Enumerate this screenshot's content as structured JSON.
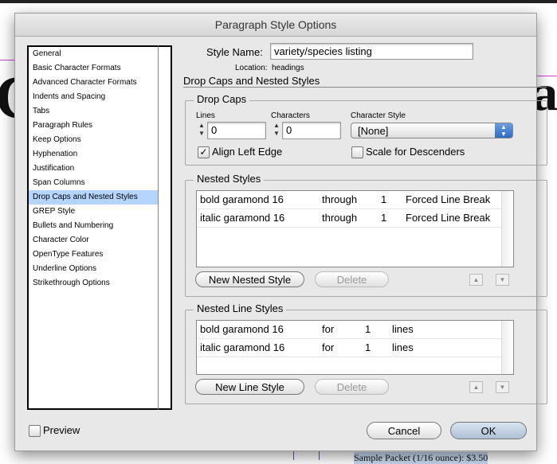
{
  "dialog": {
    "title": "Paragraph Style Options"
  },
  "sidebar": {
    "items": [
      {
        "label": "General"
      },
      {
        "label": "Basic Character Formats"
      },
      {
        "label": "Advanced Character Formats"
      },
      {
        "label": "Indents and Spacing"
      },
      {
        "label": "Tabs"
      },
      {
        "label": "Paragraph Rules"
      },
      {
        "label": "Keep Options"
      },
      {
        "label": "Hyphenation"
      },
      {
        "label": "Justification"
      },
      {
        "label": "Span Columns"
      },
      {
        "label": "Drop Caps and Nested Styles",
        "selected": true
      },
      {
        "label": "GREP Style"
      },
      {
        "label": "Bullets and Numbering"
      },
      {
        "label": "Character Color"
      },
      {
        "label": "OpenType Features"
      },
      {
        "label": "Underline Options"
      },
      {
        "label": "Strikethrough Options"
      }
    ]
  },
  "style_name": {
    "label": "Style Name:",
    "value": "variety/species listing"
  },
  "location": {
    "label": "Location:",
    "value": "headings"
  },
  "section_title": "Drop Caps and Nested Styles",
  "drop_caps": {
    "title": "Drop Caps",
    "lines_label": "Lines",
    "lines_value": "0",
    "characters_label": "Characters",
    "characters_value": "0",
    "char_style_label": "Character Style",
    "char_style_value": "[None]",
    "align_left_edge": {
      "label": "Align Left Edge",
      "checked": true
    },
    "scale_descenders": {
      "label": "Scale for Descenders",
      "checked": false
    }
  },
  "nested_styles": {
    "title": "Nested Styles",
    "rows": [
      [
        "bold garamond 16",
        "through",
        "1",
        "Forced Line Break"
      ],
      [
        "italic garamond 16",
        "through",
        "1",
        "Forced Line Break"
      ]
    ],
    "new_label": "New Nested Style",
    "delete_label": "Delete"
  },
  "nested_line_styles": {
    "title": "Nested Line Styles",
    "rows": [
      [
        "bold garamond 16",
        "for",
        "1",
        "lines"
      ],
      [
        "italic garamond 16",
        "for",
        "1",
        "lines"
      ]
    ],
    "new_label": "New Line Style",
    "delete_label": "Delete"
  },
  "preview": {
    "label": "Preview",
    "checked": false
  },
  "buttons": {
    "cancel": "Cancel",
    "ok": "OK"
  },
  "background": {
    "bottom_text": "Sample Packet (1/16 ounce): $3.50"
  },
  "icons": {
    "up": "▲",
    "down": "▼",
    "check": "✓"
  }
}
